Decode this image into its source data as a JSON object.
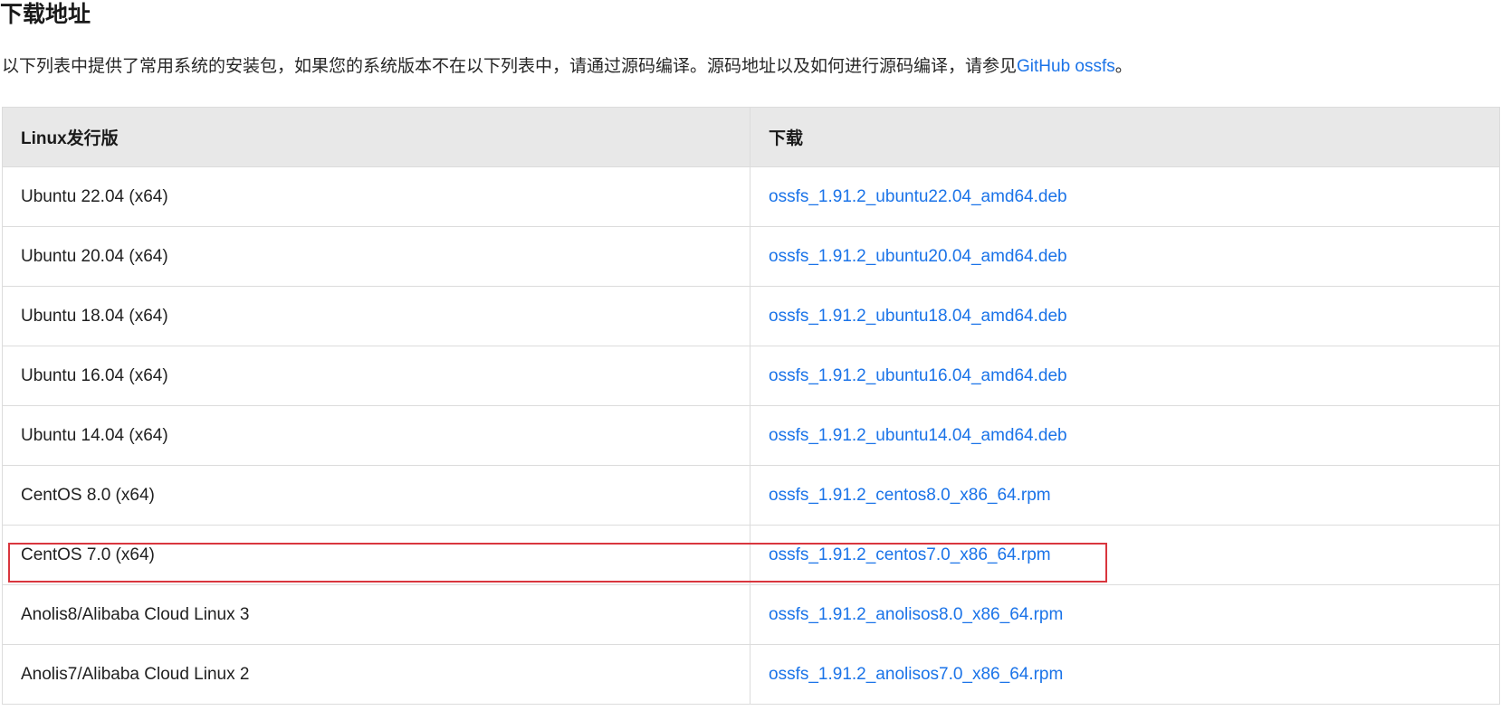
{
  "title": "下载地址",
  "intro": {
    "text": "以下列表中提供了常用系统的安装包，如果您的系统版本不在以下列表中，请通过源码编译。源码地址以及如何进行源码编译，请参见",
    "link_label": "GitHub ossfs",
    "suffix": "。"
  },
  "table": {
    "headers": [
      "Linux发行版",
      "下载"
    ],
    "rows": [
      {
        "distro": "Ubuntu 22.04 (x64)",
        "file": "ossfs_1.91.2_ubuntu22.04_amd64.deb"
      },
      {
        "distro": "Ubuntu 20.04 (x64)",
        "file": "ossfs_1.91.2_ubuntu20.04_amd64.deb"
      },
      {
        "distro": "Ubuntu 18.04 (x64)",
        "file": "ossfs_1.91.2_ubuntu18.04_amd64.deb"
      },
      {
        "distro": "Ubuntu 16.04 (x64)",
        "file": "ossfs_1.91.2_ubuntu16.04_amd64.deb"
      },
      {
        "distro": "Ubuntu 14.04 (x64)",
        "file": "ossfs_1.91.2_ubuntu14.04_amd64.deb"
      },
      {
        "distro": "CentOS 8.0 (x64)",
        "file": "ossfs_1.91.2_centos8.0_x86_64.rpm"
      },
      {
        "distro": "CentOS 7.0 (x64)",
        "file": "ossfs_1.91.2_centos7.0_x86_64.rpm"
      },
      {
        "distro": "Anolis8/Alibaba Cloud Linux 3",
        "file": "ossfs_1.91.2_anolisos8.0_x86_64.rpm"
      },
      {
        "distro": "Anolis7/Alibaba Cloud Linux 2",
        "file": "ossfs_1.91.2_anolisos7.0_x86_64.rpm"
      }
    ]
  },
  "colors": {
    "link": "#1a73e8",
    "header_bg": "#e8e8e8",
    "highlight": "#d9363e"
  }
}
